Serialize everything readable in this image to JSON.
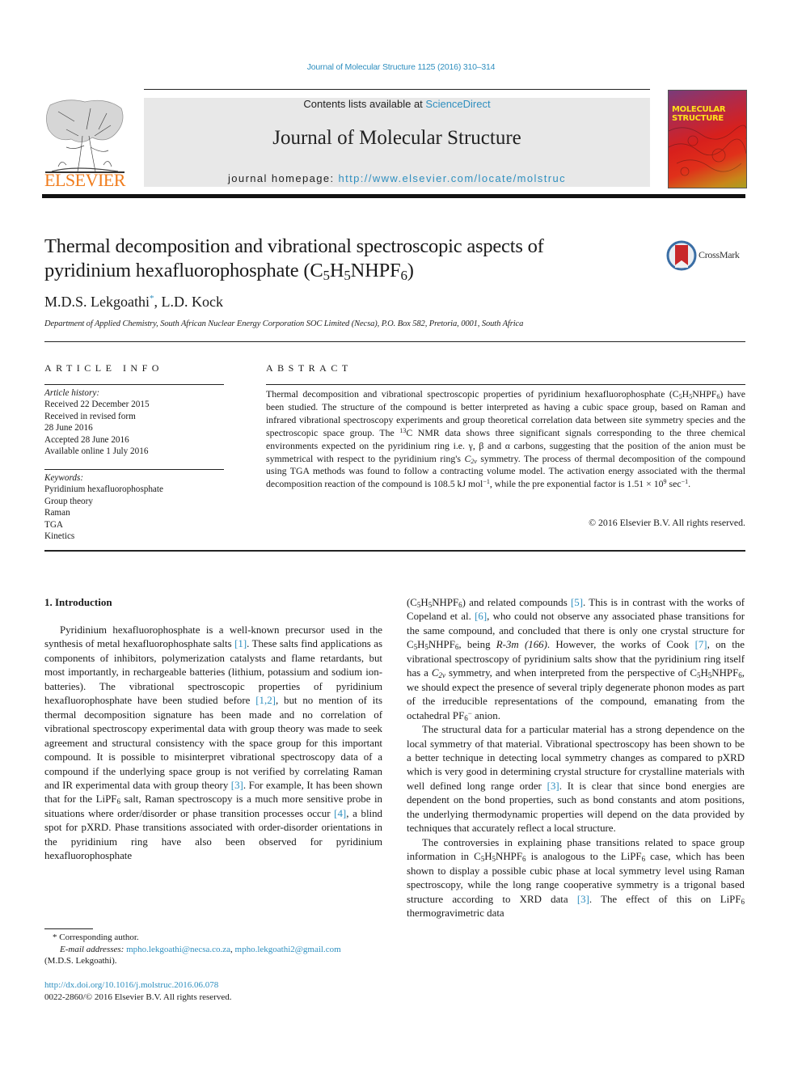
{
  "running_header": "Journal of Molecular Structure 1125 (2016) 310–314",
  "banner": {
    "contents_prefix": "Contents lists available at ",
    "contents_link": "ScienceDirect",
    "journal_name": "Journal of Molecular Structure",
    "homepage_prefix": "journal homepage: ",
    "homepage_link": "http://www.elsevier.com/locate/molstruc"
  },
  "publisher_logo": {
    "icon": "elsevier-tree-icon",
    "wordmark": "ELSEVIER",
    "color": "#f07c1c"
  },
  "cover": {
    "title_line1": "MOLECULAR",
    "title_line2": "STRUCTURE"
  },
  "crossmark": {
    "icon": "crossmark-icon",
    "label": "CrossMark"
  },
  "article": {
    "title_part1": "Thermal decomposition and vibrational spectroscopic aspects of",
    "title_part2": "pyridinium hexafluorophosphate (C",
    "title_sub1": "5",
    "title_part3": "H",
    "title_sub2": "5",
    "title_part4": "NHPF",
    "title_sub3": "6",
    "title_part5": ")",
    "author1": "M.D.S. Lekgoathi",
    "author1_mark": "*",
    "author_sep": ", ",
    "author2": "L.D. Kock",
    "affiliation": "Department of Applied Chemistry, South African Nuclear Energy Corporation SOC Limited (Necsa), P.O. Box 582, Pretoria, 0001, South Africa"
  },
  "article_info": {
    "heading": "ARTICLE INFO",
    "history_label": "Article history:",
    "history": [
      "Received 22 December 2015",
      "Received in revised form",
      "28 June 2016",
      "Accepted 28 June 2016",
      "Available online 1 July 2016"
    ],
    "keywords_label": "Keywords:",
    "keywords": [
      "Pyridinium hexafluorophosphate",
      "Group theory",
      "Raman",
      "TGA",
      "Kinetics"
    ]
  },
  "abstract": {
    "heading": "ABSTRACT",
    "t1": "Thermal decomposition and vibrational spectroscopic properties of pyridinium hexafluorophosphate (C",
    "t2": "H",
    "t3": "NHPF",
    "t4": ") have been studied. The structure of the compound is better interpreted as having a cubic space group, based on Raman and infrared vibrational spectroscopy experiments and group theoretical correlation data between site symmetry species and the spectroscopic space group. The ",
    "t5": "13",
    "t6": "C NMR data shows three significant signals corresponding to the three chemical environments expected on the pyridinium ring i.e. γ, β and α carbons, suggesting that the position of the anion must be symmetrical with respect to the pyridinium ring's ",
    "t7": "C",
    "t8": "2v",
    "t9": " symmetry. The process of thermal decomposition of the compound using TGA methods was found to follow a contracting volume model. The activation energy associated with the thermal decomposition reaction of the compound is 108.5 kJ mol",
    "t10": "−1",
    "t11": ", while the pre exponential factor is 1.51 × 10",
    "t12": "9",
    "t13": " sec",
    "t14": "−1",
    "t15": ".",
    "s5": "5",
    "s6": "6",
    "copyright": "© 2016 Elsevier B.V. All rights reserved."
  },
  "body": {
    "section_heading": "1.  Introduction",
    "l1a": "Pyridinium hexafluorophosphate is a well-known precursor used in the synthesis of metal hexafluorophosphate salts ",
    "ref1": "[1]",
    "l1b": ". These salts find applications as components of inhibitors, polymerization catalysts and flame retardants, but most importantly, in rechargeable batteries (lithium, potassium and sodium ion-batteries). The vibrational spectroscopic properties of pyridinium hexafluorophosphate have been studied before ",
    "ref12": "[1,2]",
    "l1c": ", but no mention of its thermal decomposition signature has been made and no correlation of vibrational spectroscopy experimental data with group theory was made to seek agreement and structural consistency with the space group for this important compound. It is possible to misinterpret vibrational spectroscopy data of a compound if the underlying space group is not verified by correlating Raman and IR experimental data with group theory ",
    "ref3": "[3]",
    "l1d": ". For example, It has been shown that for the LiPF",
    "l1e": " salt, Raman spectroscopy is a much more sensitive probe in situations where order/disorder or phase transition processes occur ",
    "ref4": "[4]",
    "l1f": ", a blind spot for pXRD. Phase transitions associated with order-disorder orientations in the pyridinium ring have also been observed for pyridinium hexafluorophosphate",
    "r1a": "(C",
    "r1b": "H",
    "r1c": "NHPF",
    "r1d": ") and related compounds ",
    "ref5": "[5]",
    "r1e": ". This is in contrast with the works of Copeland et al. ",
    "ref6": "[6]",
    "r1f": ", who could not observe any associated phase transitions for the same compound, and concluded that there is only one crystal structure for C",
    "r1g": "H",
    "r1h": "NHPF",
    "r1i": ", being ",
    "r1j": "R-3m (166)",
    "r1k": ". However, the works of Cook ",
    "ref7": "[7]",
    "r1l": ", on the vibrational spectroscopy of pyridinium salts show that the pyridinium ring itself has a ",
    "r1m": "C",
    "r1n": "2v",
    "r1o": " symmetry, and when interpreted from the perspective of C",
    "r1p": "H",
    "r1q": "NHPF",
    "r1r": ", we should expect the presence of several triply degenerate phonon modes as part of the irreducible representations of the compound, emanating from the octahedral PF",
    "r1s": "−",
    "r1t": " anion.",
    "r2a": "The structural data for a particular material has a strong dependence on the local symmetry of that material. Vibrational spectroscopy has been shown to be a better technique in detecting local symmetry changes as compared to pXRD which is very good in determining crystal structure for crystalline materials with well defined long range order ",
    "ref3b": "[3]",
    "r2b": ". It is clear that since bond energies are dependent on the bond properties, such as bond constants and atom positions, the underlying thermodynamic properties will depend on the data provided by techniques that accurately reflect a local structure.",
    "r3a": "The controversies in explaining phase transitions related to space group information in C",
    "r3b": "H",
    "r3c": "NHPF",
    "r3d": " is analogous to the LiPF",
    "r3e": " case, which has been shown to display a possible cubic phase at local symmetry level using Raman spectroscopy, while the long range cooperative symmetry is a trigonal based structure according to XRD data ",
    "ref3c": "[3]",
    "r3f": ". The effect of this on LiPF",
    "r3g": " thermogravimetric data",
    "s5": "5",
    "s6": "6"
  },
  "footnote": {
    "mark": "*",
    "corresponding": " Corresponding author.",
    "email_label": "E-mail addresses:",
    "email1": "mpho.lekgoathi@necsa.co.za",
    "email_sep": ",  ",
    "email2": "mpho.lekgoathi2@gmail.com",
    "email_owner": "(M.D.S. Lekgoathi).",
    "doi": "http://dx.doi.org/10.1016/j.molstruc.2016.06.078",
    "issn": "0022-2860/© 2016 Elsevier B.V. All rights reserved."
  },
  "colors": {
    "link": "#2f8fbf",
    "elsevier_orange": "#f07c1c",
    "banner_bg": "#e8e8e8"
  }
}
